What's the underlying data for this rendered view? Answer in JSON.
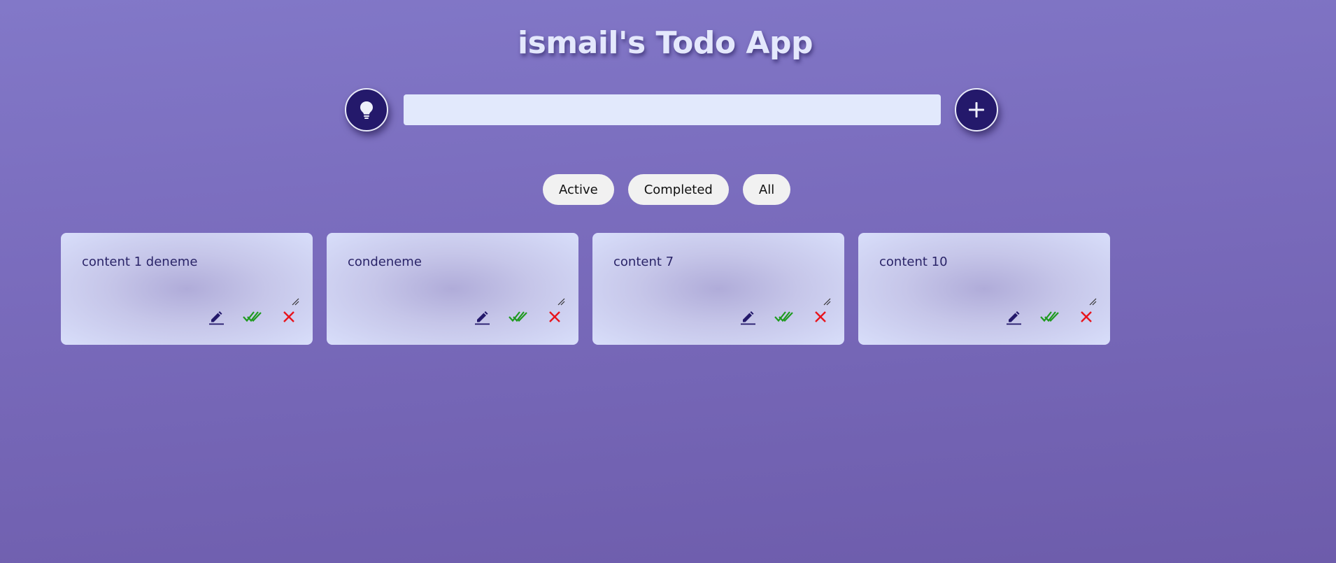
{
  "app": {
    "title": "ismail's Todo App"
  },
  "toolbar": {
    "idea_icon": "lightbulb-icon",
    "add_icon": "plus-icon",
    "input_value": "",
    "input_placeholder": ""
  },
  "filters": [
    {
      "label": "Active"
    },
    {
      "label": "Completed"
    },
    {
      "label": "All"
    }
  ],
  "todos": [
    {
      "text": "content 1 deneme"
    },
    {
      "text": "condeneme"
    },
    {
      "text": "content 7"
    },
    {
      "text": "content 10"
    }
  ],
  "colors": {
    "accent": "#24196b",
    "edit": "#24196b",
    "complete": "#1f9a1f",
    "delete": "#e8141c"
  }
}
